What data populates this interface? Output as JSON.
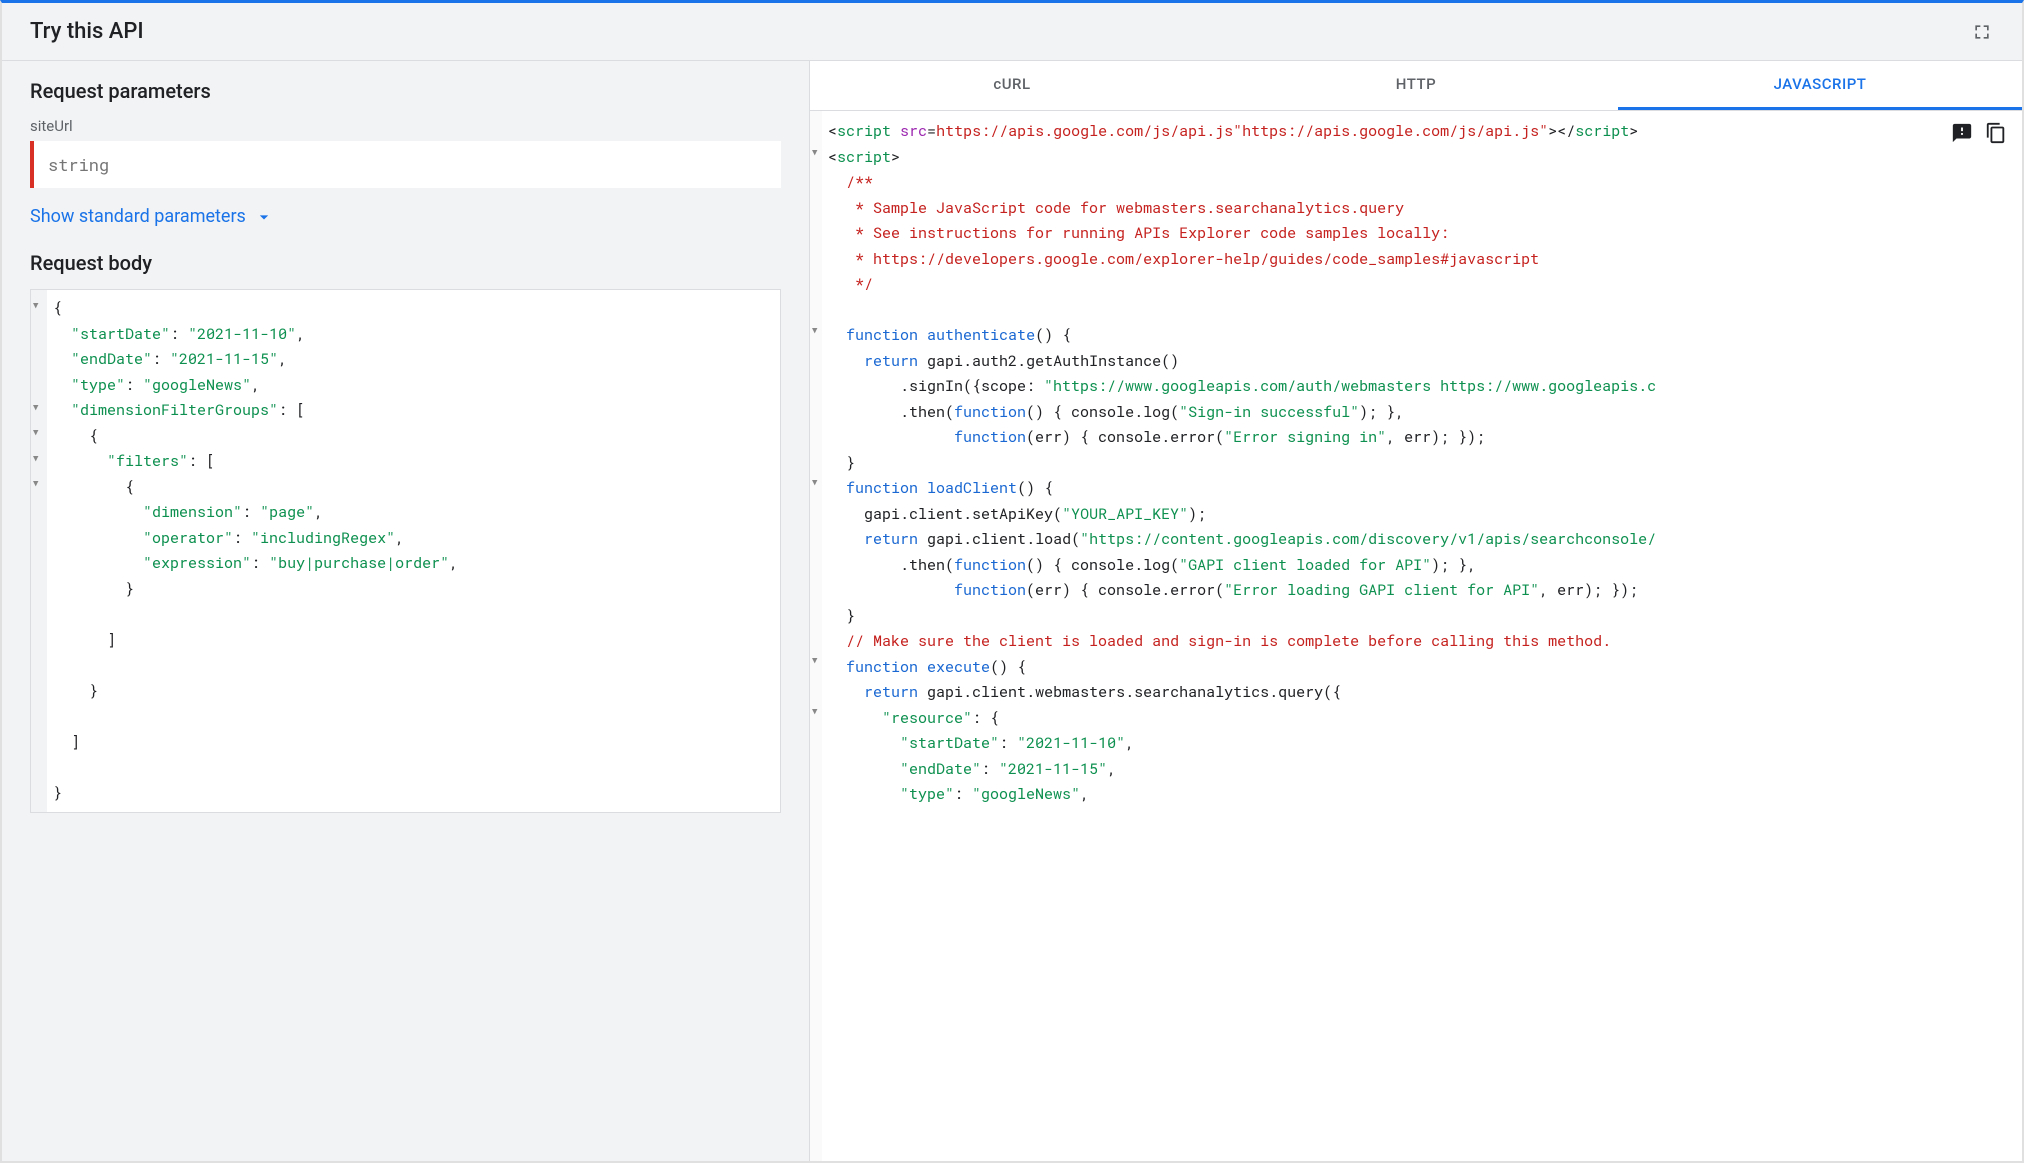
{
  "header": {
    "title": "Try this API"
  },
  "left": {
    "request_parameters_title": "Request parameters",
    "siteUrl_label": "siteUrl",
    "siteUrl_placeholder": "string",
    "show_standard_link": "Show standard parameters",
    "request_body_title": "Request body",
    "body_json": {
      "startDate": "2021-11-10",
      "endDate": "2021-11-15",
      "type": "googleNews",
      "dimensionFilterGroups": [
        {
          "filters": [
            {
              "dimension": "page",
              "operator": "includingRegex",
              "expression": "buy|purchase|order"
            }
          ]
        }
      ]
    }
  },
  "tabs": {
    "curl": "cURL",
    "http": "HTTP",
    "javascript": "JAVASCRIPT"
  },
  "code": {
    "script_src": "https://apis.google.com/js/api.js",
    "doc1": "/**",
    "doc2": " * Sample JavaScript code for webmasters.searchanalytics.query",
    "doc3": " * See instructions for running APIs Explorer code samples locally:",
    "doc4": " * https://developers.google.com/explorer-help/guides/code_samples#javascript",
    "doc5": " */",
    "kw_function": "function",
    "kw_return": "return",
    "fn_authenticate": "authenticate",
    "auth_line1": "gapi.auth2.getAuthInstance()",
    "auth_signin_prefix": ".signIn({scope: ",
    "auth_scope": "\"https://www.googleapis.com/auth/webmasters https://www.googleapis.c",
    "auth_then_prefix": ".then(",
    "auth_then_log": "() { console.log(",
    "auth_then_msg": "\"Sign-in successful\"",
    "auth_then_suffix": "); },",
    "auth_err_fn": "(err) { console.error(",
    "auth_err_msg": "\"Error signing in\"",
    "auth_err_suffix": ", err); });",
    "close_brace": "}",
    "fn_loadClient": "loadClient",
    "load_setkey": "gapi.client.setApiKey(",
    "load_key": "\"YOUR_API_KEY\"",
    "load_setkey_suffix": ");",
    "load_load": "gapi.client.load(",
    "load_url": "\"https://content.googleapis.com/discovery/v1/apis/searchconsole/",
    "load_then_log": "() { console.log(",
    "load_then_msg": "\"GAPI client loaded for API\"",
    "load_then_suffix": "); },",
    "load_err_msg": "\"Error loading GAPI client for API\"",
    "comment_make_sure": "// Make sure the client is loaded and sign-in is complete before calling this method.",
    "fn_execute": "execute",
    "exec_call": "gapi.client.webmasters.searchanalytics.query({",
    "res_key": "\"resource\"",
    "res_colon": ": {",
    "sd_key": "\"startDate\"",
    "sd_val": "\"2021-11-10\"",
    "ed_key": "\"endDate\"",
    "ed_val": "\"2021-11-15\"",
    "ty_key": "\"type\"",
    "ty_val": "\"googleNews\""
  }
}
